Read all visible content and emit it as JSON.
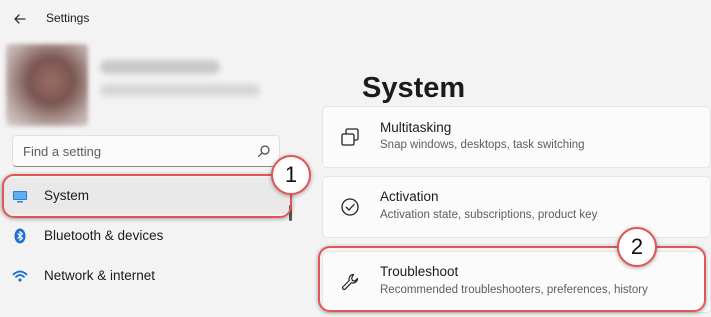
{
  "app": {
    "title": "Settings"
  },
  "search": {
    "placeholder": "Find a setting"
  },
  "nav": {
    "items": [
      {
        "label": "System",
        "icon": "system-display-icon",
        "selected": true
      },
      {
        "label": "Bluetooth & devices",
        "icon": "bluetooth-icon"
      },
      {
        "label": "Network & internet",
        "icon": "wifi-icon"
      }
    ]
  },
  "main": {
    "title": "System",
    "cards": [
      {
        "title": "Multitasking",
        "subtitle": "Snap windows, desktops, task switching",
        "icon": "multitasking-icon"
      },
      {
        "title": "Activation",
        "subtitle": "Activation state, subscriptions, product key",
        "icon": "activation-check-icon"
      },
      {
        "title": "Troubleshoot",
        "subtitle": "Recommended troubleshooters, preferences, history",
        "icon": "wrench-icon"
      }
    ]
  },
  "annotations": {
    "step1": "1",
    "step2": "2"
  },
  "colors": {
    "annotation": "#e05656",
    "accent": "#0067c0"
  }
}
